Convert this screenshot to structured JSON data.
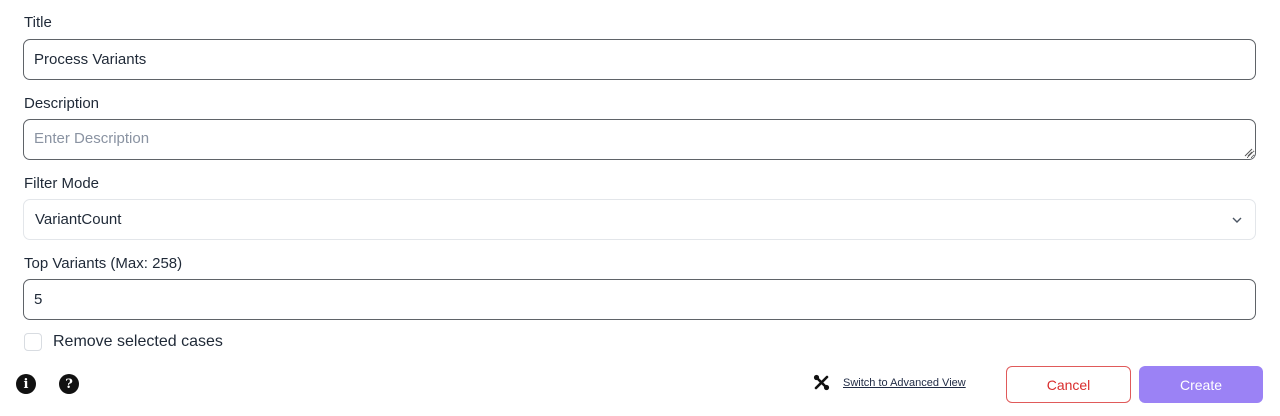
{
  "form": {
    "title_label": "Title",
    "title_value": "Process Variants",
    "description_label": "Description",
    "description_placeholder": "Enter Description",
    "filter_mode_label": "Filter Mode",
    "filter_mode_value": "VariantCount",
    "top_variants_label": "Top Variants (Max: 258)",
    "top_variants_value": "5",
    "remove_selected_label": "Remove selected cases",
    "remove_selected_checked": false
  },
  "footer": {
    "info_icon": "info-circle-icon",
    "help_icon": "question-circle-icon",
    "advanced_icon": "tools-icon",
    "advanced_link": "Switch to Advanced View",
    "cancel_label": "Cancel",
    "create_label": "Create"
  },
  "colors": {
    "create_button": "#9b82f5",
    "cancel_border": "#e05a5a",
    "cancel_text": "#d92d2d"
  }
}
